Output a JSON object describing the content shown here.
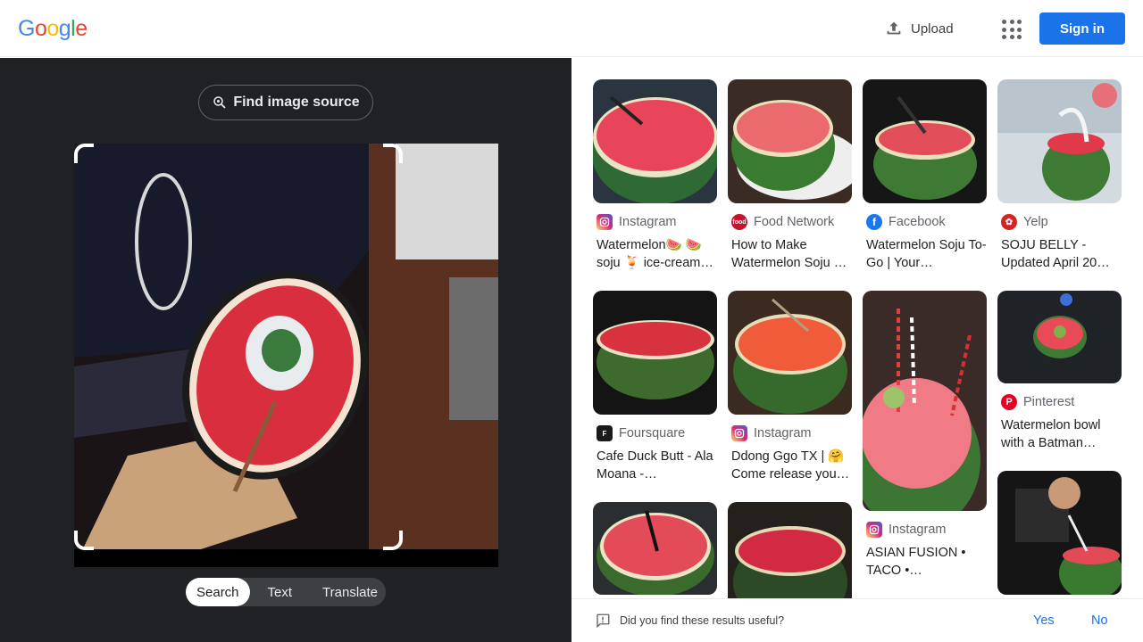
{
  "header": {
    "logo": [
      "G",
      "o",
      "o",
      "g",
      "l",
      "e"
    ],
    "logo_colors": [
      "#4285f4",
      "#ea4335",
      "#fbbc05",
      "#4285f4",
      "#34a853",
      "#ea4335"
    ],
    "upload_label": "Upload",
    "apps_icon": "apps-grid-icon",
    "signin_label": "Sign in"
  },
  "left": {
    "find_source_label": "Find image source",
    "modes": [
      {
        "label": "Search",
        "active": true
      },
      {
        "label": "Text",
        "active": false
      },
      {
        "label": "Translate",
        "active": false
      }
    ]
  },
  "results": [
    {
      "source": "Instagram",
      "title": "Watermelon🍉 🍉 soju 🍹 ice-cream…",
      "favicon": "instagram-icon",
      "fav_color": "#d62976"
    },
    {
      "source": "Food Network",
      "title": "How to Make Watermelon Soju …",
      "favicon": "food-network-icon",
      "fav_color": "#c4122f"
    },
    {
      "source": "Facebook",
      "title": "Watermelon Soju To-Go | Your…",
      "favicon": "facebook-icon",
      "fav_color": "#1877f2"
    },
    {
      "source": "Yelp",
      "title": "SOJU BELLY - Updated April 20…",
      "favicon": "yelp-icon",
      "fav_color": "#d32323"
    },
    {
      "source": "Foursquare",
      "title": "Cafe Duck Butt - Ala Moana -…",
      "favicon": "foursquare-icon",
      "fav_color": "#1a1a1a"
    },
    {
      "source": "Instagram",
      "title": "Ddong Ggo TX | 🤗 Come release you…",
      "favicon": "instagram-icon",
      "fav_color": "#d62976"
    },
    {
      "source": "Instagram",
      "title": "ASIAN FUSION • TACO •…",
      "favicon": "instagram-icon",
      "fav_color": "#d62976"
    },
    {
      "source": "Pinterest",
      "title": "Watermelon bowl with a Batman…",
      "favicon": "pinterest-icon",
      "fav_color": "#e60023"
    }
  ],
  "feedback": {
    "question": "Did you find these results useful?",
    "yes_label": "Yes",
    "no_label": "No"
  }
}
